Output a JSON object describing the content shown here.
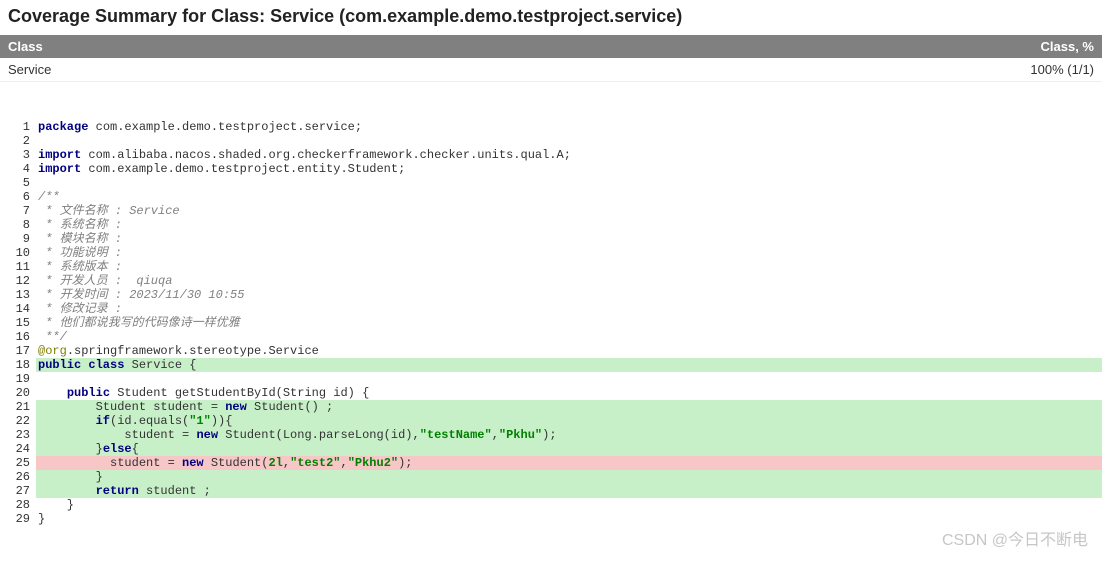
{
  "title": "Coverage Summary for Class: Service (com.example.demo.testproject.service)",
  "table": {
    "headers": {
      "class": "Class",
      "pct": "Class, %"
    },
    "row": {
      "class": "Service",
      "pct": "100% (1/1)"
    }
  },
  "watermark": "CSDN @今日不断电",
  "code": [
    {
      "n": 1,
      "cov": "",
      "segs": [
        {
          "c": "kw",
          "t": "package"
        },
        {
          "t": " com.example.demo.testproject.service;"
        }
      ]
    },
    {
      "n": 2,
      "cov": "",
      "segs": []
    },
    {
      "n": 3,
      "cov": "",
      "segs": [
        {
          "c": "kw",
          "t": "import"
        },
        {
          "t": " com.alibaba.nacos.shaded.org.checkerframework.checker.units.qual.A;"
        }
      ]
    },
    {
      "n": 4,
      "cov": "",
      "segs": [
        {
          "c": "kw",
          "t": "import"
        },
        {
          "t": " com.example.demo.testproject.entity.Student;"
        }
      ]
    },
    {
      "n": 5,
      "cov": "",
      "segs": []
    },
    {
      "n": 6,
      "cov": "",
      "segs": [
        {
          "c": "cm",
          "t": "/**"
        }
      ]
    },
    {
      "n": 7,
      "cov": "",
      "segs": [
        {
          "c": "cm",
          "t": " * 文件名称 : Service"
        }
      ]
    },
    {
      "n": 8,
      "cov": "",
      "segs": [
        {
          "c": "cm",
          "t": " * 系统名称 :"
        }
      ]
    },
    {
      "n": 9,
      "cov": "",
      "segs": [
        {
          "c": "cm",
          "t": " * 模块名称 :"
        }
      ]
    },
    {
      "n": 10,
      "cov": "",
      "segs": [
        {
          "c": "cm",
          "t": " * 功能说明 :"
        }
      ]
    },
    {
      "n": 11,
      "cov": "",
      "segs": [
        {
          "c": "cm",
          "t": " * 系统版本 :"
        }
      ]
    },
    {
      "n": 12,
      "cov": "",
      "segs": [
        {
          "c": "cm",
          "t": " * 开发人员 :  qiuqa"
        }
      ]
    },
    {
      "n": 13,
      "cov": "",
      "segs": [
        {
          "c": "cm",
          "t": " * 开发时间 : 2023/11/30 10:55"
        }
      ]
    },
    {
      "n": 14,
      "cov": "",
      "segs": [
        {
          "c": "cm",
          "t": " * 修改记录 :"
        }
      ]
    },
    {
      "n": 15,
      "cov": "",
      "segs": [
        {
          "c": "cm",
          "t": " * 他们都说我写的代码像诗一样优雅"
        }
      ]
    },
    {
      "n": 16,
      "cov": "",
      "segs": [
        {
          "c": "cm",
          "t": " **/"
        }
      ]
    },
    {
      "n": 17,
      "cov": "",
      "segs": [
        {
          "c": "an",
          "t": "@org"
        },
        {
          "t": ".springframework.stereotype.Service"
        }
      ]
    },
    {
      "n": 18,
      "cov": "fc",
      "segs": [
        {
          "c": "kw",
          "t": "public class"
        },
        {
          "t": " Service {"
        }
      ]
    },
    {
      "n": 19,
      "cov": "",
      "segs": []
    },
    {
      "n": 20,
      "cov": "",
      "segs": [
        {
          "t": "    "
        },
        {
          "c": "kw",
          "t": "public"
        },
        {
          "t": " Student getStudentById(String id) {"
        }
      ]
    },
    {
      "n": 21,
      "cov": "fc",
      "segs": [
        {
          "t": "        Student student = "
        },
        {
          "c": "kw",
          "t": "new"
        },
        {
          "t": " Student() ;"
        }
      ]
    },
    {
      "n": 22,
      "cov": "fc",
      "segs": [
        {
          "t": "        "
        },
        {
          "c": "kw",
          "t": "if"
        },
        {
          "t": "(id.equals("
        },
        {
          "c": "st",
          "t": "\"1\""
        },
        {
          "t": ")){"
        }
      ]
    },
    {
      "n": 23,
      "cov": "fc",
      "segs": [
        {
          "t": "            student = "
        },
        {
          "c": "kw",
          "t": "new"
        },
        {
          "t": " Student(Long.parseLong(id),"
        },
        {
          "c": "st",
          "t": "\"testName\""
        },
        {
          "t": ","
        },
        {
          "c": "st",
          "t": "\"Pkhu\""
        },
        {
          "t": ");"
        }
      ]
    },
    {
      "n": 24,
      "cov": "fc",
      "segs": [
        {
          "t": "        }"
        },
        {
          "c": "kw",
          "t": "else"
        },
        {
          "t": "{"
        }
      ]
    },
    {
      "n": 25,
      "cov": "nc",
      "segs": [
        {
          "t": "          student = "
        },
        {
          "c": "kw",
          "t": "new"
        },
        {
          "t": " Student("
        },
        {
          "c": "st",
          "t": "2l"
        },
        {
          "t": ","
        },
        {
          "c": "st",
          "t": "\"test2\""
        },
        {
          "t": ","
        },
        {
          "c": "st",
          "t": "\"Pkhu2\""
        },
        {
          "t": ");"
        }
      ]
    },
    {
      "n": 26,
      "cov": "fc",
      "segs": [
        {
          "t": "        }"
        }
      ]
    },
    {
      "n": 27,
      "cov": "fc",
      "segs": [
        {
          "t": "        "
        },
        {
          "c": "kw",
          "t": "return"
        },
        {
          "t": " student ;"
        }
      ]
    },
    {
      "n": 28,
      "cov": "",
      "segs": [
        {
          "t": "    }"
        }
      ]
    },
    {
      "n": 29,
      "cov": "",
      "segs": [
        {
          "t": "}"
        }
      ]
    }
  ]
}
